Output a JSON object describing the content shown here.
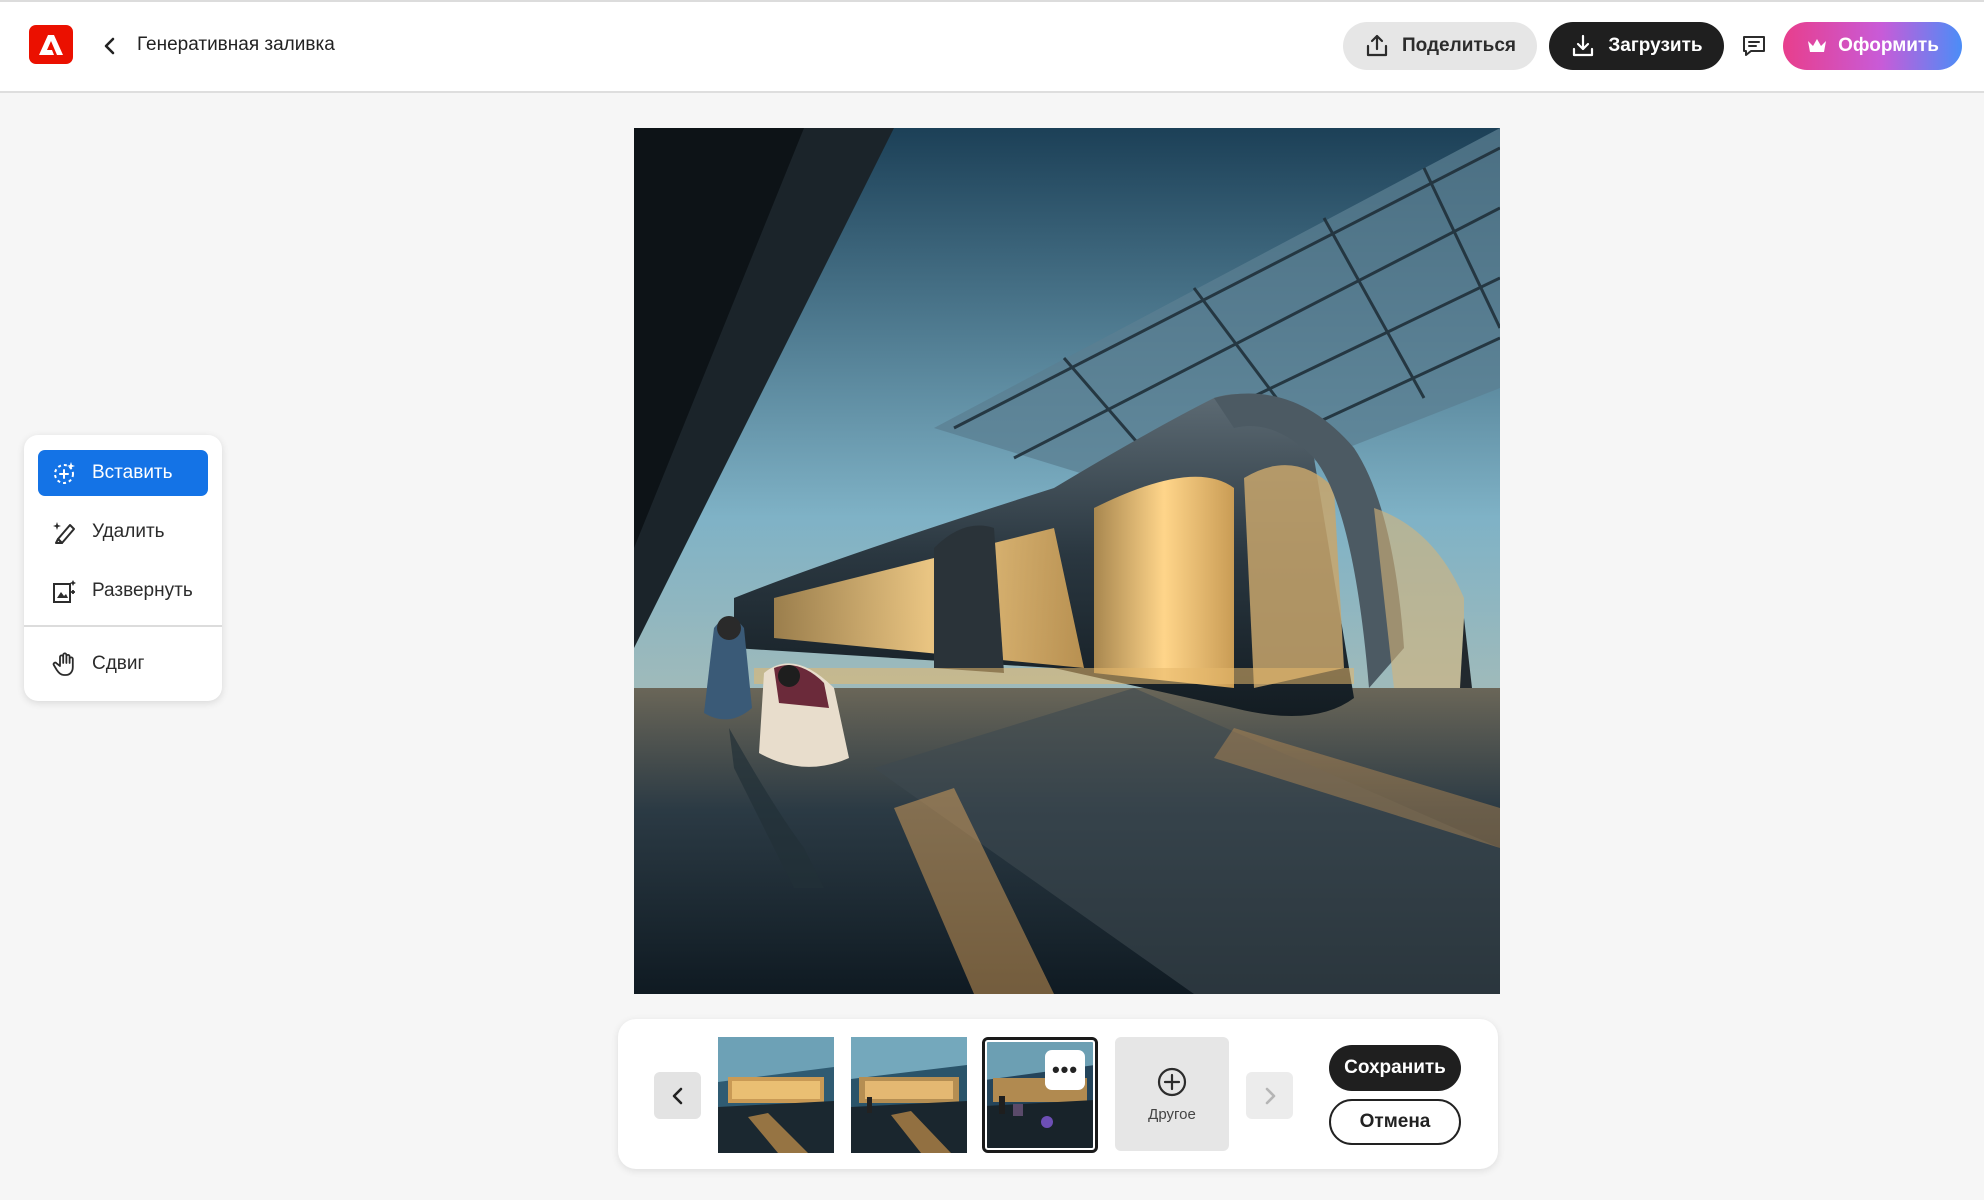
{
  "header": {
    "title": "Генеративная заливка",
    "share_label": "Поделиться",
    "download_label": "Загрузить",
    "upgrade_label": "Оформить",
    "colors": {
      "logo": "#eb1000",
      "download_bg": "#1f1f1f",
      "upgrade_gradient": [
        "#e83e8c",
        "#c85bd8",
        "#4b8df7"
      ]
    }
  },
  "tools": {
    "items": [
      {
        "label": "Вставить",
        "icon": "insert-icon",
        "active": true
      },
      {
        "label": "Удалить",
        "icon": "eraser-icon",
        "active": false
      },
      {
        "label": "Развернуть",
        "icon": "expand-icon",
        "active": false
      },
      {
        "label": "Сдвиг",
        "icon": "hand-icon",
        "active": false
      }
    ],
    "active_color": "#1473e6"
  },
  "canvas": {
    "image_subject": "futuristic glass train station with people on reflective floor"
  },
  "variations": {
    "thumbnails": [
      {
        "selected": false
      },
      {
        "selected": false
      },
      {
        "selected": true,
        "more_label": "•••"
      }
    ],
    "more_label": "Другое",
    "save_label": "Сохранить",
    "cancel_label": "Отмена"
  }
}
